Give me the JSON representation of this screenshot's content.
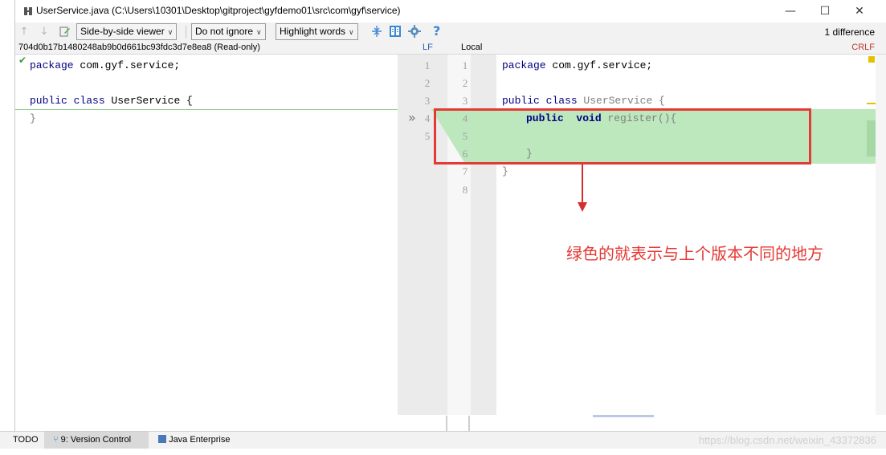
{
  "window": {
    "title": "UserService.java (C:\\Users\\10301\\Desktop\\gitproject\\gyfdemo01\\src\\com\\gyf\\service)",
    "minimize_glyph": "—",
    "maximize_glyph": "☐",
    "close_glyph": "✕"
  },
  "toolbar": {
    "viewer_mode": "Side-by-side viewer",
    "whitespace_mode": "Do not ignore",
    "highlight_mode": "Highlight words",
    "help_glyph": "?",
    "difference_count": "1 difference"
  },
  "header": {
    "left_revision": "704d0b17b1480248ab9b0d661bc93fdc3d7e8ea8 (Read-only)",
    "left_line_sep": "LF",
    "right_label": "Local",
    "right_line_sep": "CRLF"
  },
  "left_code": {
    "line1_kw": "package",
    "line1_rest": " com.gyf.service;",
    "line3_kw": "public class",
    "line3_rest": " UserService {",
    "line4": "}"
  },
  "right_code": {
    "line1_kw": "package",
    "line1_rest": " com.gyf.service;",
    "line3_kw": "public class",
    "line3_rest": " UserService {",
    "line4_kw": "public  void",
    "line4_rest": " register(){",
    "line6": "}",
    "line7": "}"
  },
  "line_numbers": {
    "left": [
      "1",
      "2",
      "3",
      "4",
      "5"
    ],
    "right": [
      "1",
      "2",
      "3",
      "4",
      "5",
      "6",
      "7",
      "8"
    ]
  },
  "diff_marker": "»",
  "annotation": "绿色的就表示与上个版本不同的地方",
  "statusbar": {
    "todo": "TODO",
    "version_control": "9: Version Control",
    "java_enterprise": "Java Enterprise",
    "watermark": "https://blog.csdn.net/weixin_43372836"
  },
  "colors": {
    "added_bg": "#bde7bd",
    "annotation_red": "#e53935",
    "keyword": "#000080"
  }
}
